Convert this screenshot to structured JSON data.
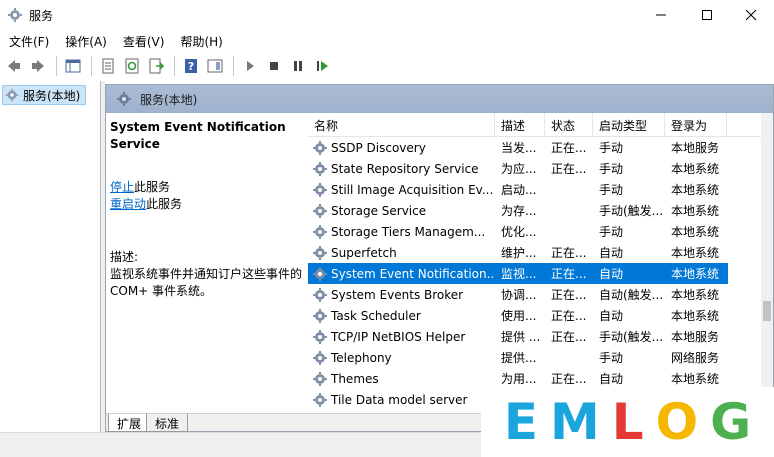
{
  "window": {
    "title": "服务"
  },
  "menu": [
    "文件(F)",
    "操作(A)",
    "查看(V)",
    "帮助(H)"
  ],
  "tree": {
    "root": "服务(本地)"
  },
  "panel": {
    "header": "服务(本地)"
  },
  "detail": {
    "service_name": "System Event Notification Service",
    "stop_link": "停止",
    "stop_suffix": "此服务",
    "restart_link": "重启动",
    "restart_suffix": "此服务",
    "desc_label": "描述:",
    "desc_text": "监视系统事件并通知订户这些事件的 COM+ 事件系统。"
  },
  "table": {
    "headers": {
      "name": "名称",
      "desc": "描述",
      "status": "状态",
      "startup": "启动类型",
      "logon": "登录为"
    },
    "rows": [
      {
        "name": "SSDP Discovery",
        "desc": "当发...",
        "status": "正在...",
        "startup": "手动",
        "logon": "本地服务"
      },
      {
        "name": "State Repository Service",
        "desc": "为应...",
        "status": "正在...",
        "startup": "手动",
        "logon": "本地系统"
      },
      {
        "name": "Still Image Acquisition Ev...",
        "desc": "启动...",
        "status": "",
        "startup": "手动",
        "logon": "本地系统"
      },
      {
        "name": "Storage Service",
        "desc": "为存...",
        "status": "",
        "startup": "手动(触发...",
        "logon": "本地系统"
      },
      {
        "name": "Storage Tiers Managem...",
        "desc": "优化...",
        "status": "",
        "startup": "手动",
        "logon": "本地系统"
      },
      {
        "name": "Superfetch",
        "desc": "维护...",
        "status": "正在...",
        "startup": "自动",
        "logon": "本地系统"
      },
      {
        "name": "System Event Notification...",
        "desc": "监视...",
        "status": "正在...",
        "startup": "自动",
        "logon": "本地系统"
      },
      {
        "name": "System Events Broker",
        "desc": "协调...",
        "status": "正在...",
        "startup": "自动(触发...",
        "logon": "本地系统"
      },
      {
        "name": "Task Scheduler",
        "desc": "使用...",
        "status": "正在...",
        "startup": "自动",
        "logon": "本地系统"
      },
      {
        "name": "TCP/IP NetBIOS Helper",
        "desc": "提供 ...",
        "status": "正在...",
        "startup": "手动(触发...",
        "logon": "本地服务"
      },
      {
        "name": "Telephony",
        "desc": "提供...",
        "status": "",
        "startup": "手动",
        "logon": "网络服务"
      },
      {
        "name": "Themes",
        "desc": "为用...",
        "status": "正在...",
        "startup": "自动",
        "logon": "本地系统"
      },
      {
        "name": "Tile Data model server",
        "desc": "",
        "status": "",
        "startup": "",
        "logon": ""
      }
    ],
    "selected_index": 6
  },
  "tabs": [
    "扩展",
    "标准"
  ],
  "watermark": {
    "letters": [
      "E",
      "M",
      "L",
      "O",
      "G"
    ],
    "colors": [
      "#1aa5dd",
      "#1aa5dd",
      "#e53935",
      "#f5b700",
      "#4caf50"
    ]
  },
  "colors": {
    "selection": "#0078d7",
    "header": "#aabbd4",
    "link": "#0066cc"
  }
}
